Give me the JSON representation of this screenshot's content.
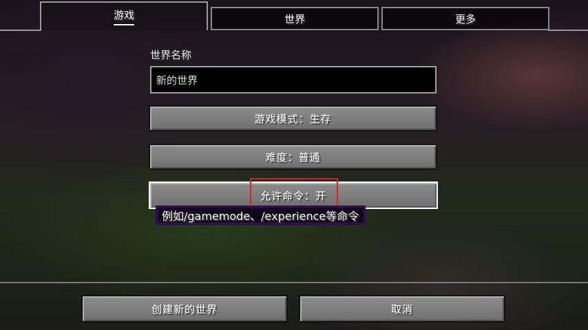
{
  "tabs": [
    {
      "label": "游戏",
      "active": true
    },
    {
      "label": "世界",
      "active": false
    },
    {
      "label": "更多",
      "active": false
    }
  ],
  "world_name": {
    "label": "世界名称",
    "value": "新的世界"
  },
  "buttons": {
    "gamemode": "游戏模式：生存",
    "difficulty": "难度：普通",
    "commands": "允许命令：开",
    "create": "创建新的世界",
    "cancel": "取消"
  },
  "tooltip": {
    "text": "例如/gamemode、/experience等命令"
  },
  "colors": {
    "highlight": "#e02020",
    "tooltip_bg": "#12061a",
    "tooltip_border": "#2a0b46"
  }
}
